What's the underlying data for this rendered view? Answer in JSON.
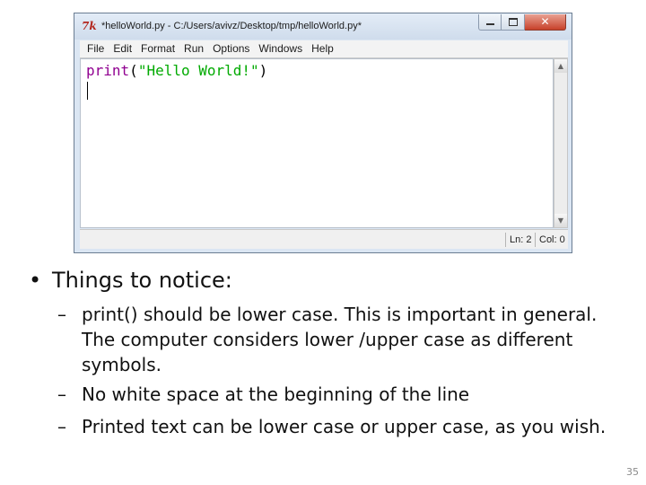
{
  "window": {
    "title": "*helloWorld.py - C:/Users/avivz/Desktop/tmp/helloWorld.py*",
    "app_icon_text": "7k",
    "controls": {
      "close_glyph": "✕"
    },
    "menu": [
      "File",
      "Edit",
      "Format",
      "Run",
      "Options",
      "Windows",
      "Help"
    ],
    "code": {
      "keyword": "print",
      "open": "(",
      "string": "\"Hello World!\"",
      "close": ")"
    },
    "status": {
      "line": "Ln: 2",
      "col": "Col: 0"
    },
    "scroll": {
      "up": "▲",
      "down": "▼"
    }
  },
  "slide": {
    "bullet_symbol": "•",
    "heading": "Things to notice:",
    "dash": "–",
    "points": [
      "print() should be lower case. This is important in general. The computer considers lower /upper case as different symbols.",
      "No white  space at the beginning of the line",
      "Printed text can be lower case or upper case, as you wish."
    ],
    "page_number": "35"
  }
}
